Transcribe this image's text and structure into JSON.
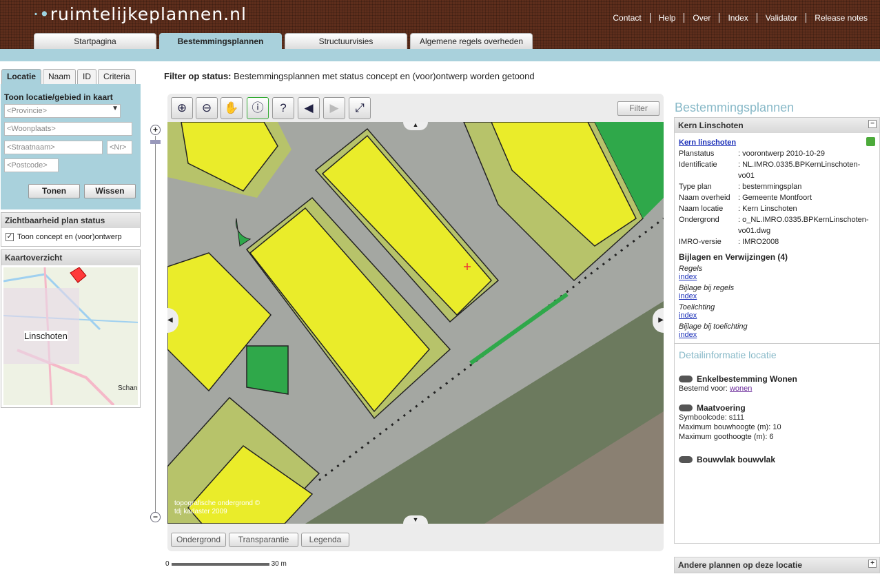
{
  "header": {
    "logo": "ruimtelijkeplannen.nl",
    "nav": [
      "Contact",
      "Help",
      "Over",
      "Index",
      "Validator",
      "Release notes"
    ]
  },
  "tabs": [
    "Startpagina",
    "Bestemmingsplannen",
    "Structuurvisies",
    "Algemene regels overheden"
  ],
  "filter": {
    "label": "Filter op status:",
    "text": "Bestemmingsplannen met status concept en (voor)ontwerp worden getoond"
  },
  "left": {
    "tabs": [
      "Locatie",
      "Naam",
      "ID",
      "Criteria"
    ],
    "title": "Toon locatie/gebied in kaart",
    "province_placeholder": "<Provincie>",
    "woonplaats_placeholder": "<Woonplaats>",
    "straat_placeholder": "<Straatnaam>",
    "nr_placeholder": "<Nr>",
    "postcode_placeholder": "<Postcode>",
    "tonen": "Tonen",
    "wissen": "Wissen",
    "zicht_title": "Zichtbaarheid plan status",
    "zicht_check": "Toon concept en (voor)ontwerp",
    "overview_title": "Kaartoverzicht",
    "overview_place": "Linschoten",
    "overview_place2": "Schans"
  },
  "map": {
    "filter_button": "Filter",
    "copyright1": "topografische ondergrond ©",
    "copyright2": "tdj kadaster 2009",
    "bottom_buttons": [
      "Ondergrond",
      "Transparantie",
      "Legenda"
    ],
    "scale_start": "0",
    "scale_end": "30 m"
  },
  "right": {
    "title": "Bestemmingsplannen",
    "plan_header": "Kern Linschoten",
    "plan_link": "Kern linschoten",
    "details": [
      {
        "k": "Planstatus",
        "v": ": voorontwerp 2010-10-29"
      },
      {
        "k": "Identificatie",
        "v": ": NL.IMRO.0335.BPKernLinschoten-vo01"
      },
      {
        "k": "Type plan",
        "v": ": bestemmingsplan"
      },
      {
        "k": "Naam overheid",
        "v": ": Gemeente Montfoort"
      },
      {
        "k": "Naam locatie",
        "v": ": Kern Linschoten"
      },
      {
        "k": "Ondergrond",
        "v": ": o_NL.IMRO.0335.BPKernLinschoten-vo01.dwg"
      },
      {
        "k": "IMRO-versie",
        "v": ": IMRO2008"
      }
    ],
    "bijlagen_title": "Bijlagen en Verwijzingen (4)",
    "bijlagen": [
      {
        "label": "Regels",
        "link": "index"
      },
      {
        "label": "Bijlage bij regels",
        "link": "index"
      },
      {
        "label": "Toelichting",
        "link": "index"
      },
      {
        "label": "Bijlage bij toelichting",
        "link": "index"
      }
    ],
    "detail_title": "Detailinformatie locatie",
    "enkel_title": "Enkelbestemming Wonen",
    "enkel_text": "Bestemd voor:",
    "enkel_link": "wonen",
    "maat_title": "Maatvoering",
    "maat_lines": [
      "Symboolcode: s111",
      "Maximum bouwhoogte (m): 10",
      "Maximum goothoogte (m): 6"
    ],
    "bouwvlak_title": "Bouwvlak bouwvlak",
    "other_plans": "Andere plannen op deze locatie"
  }
}
